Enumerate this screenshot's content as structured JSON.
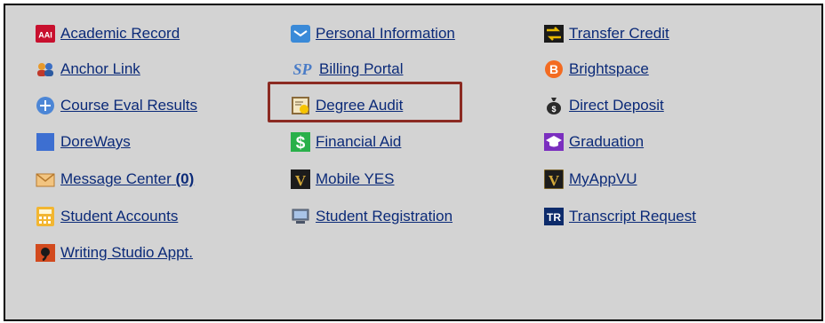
{
  "links": {
    "academic_record": "Academic Record",
    "personal_information": "Personal Information",
    "transfer_credit": "Transfer Credit",
    "anchor_link": "Anchor Link",
    "billing_portal": "Billing Portal",
    "brightspace": "Brightspace",
    "course_eval_results": "Course Eval Results",
    "degree_audit": "Degree Audit",
    "direct_deposit": "Direct Deposit",
    "doreways": "DoreWays",
    "financial_aid": "Financial Aid",
    "graduation": "Graduation",
    "message_center": "Message Center",
    "message_center_count": "(0)",
    "mobile_yes": "Mobile YES",
    "myappvu": "MyAppVU",
    "student_accounts": "Student Accounts",
    "student_registration": "Student Registration",
    "transcript_request": "Transcript Request",
    "writing_studio_appt": "Writing Studio Appt."
  },
  "icon_text": {
    "aai": "AAI",
    "sp": "SP",
    "b": "B",
    "dollar": "$",
    "v": "V",
    "tr": "TR"
  },
  "colors": {
    "link": "#0b2a78",
    "panel_bg": "#d3d3d3",
    "highlight_border": "#8b2a22"
  }
}
